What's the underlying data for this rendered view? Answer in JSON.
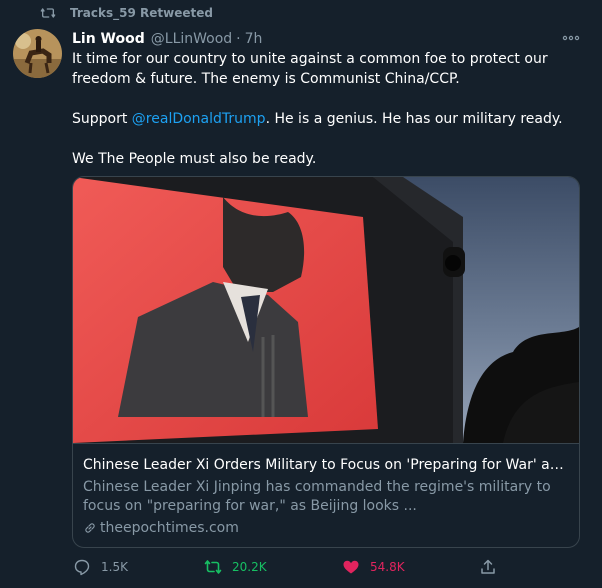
{
  "retweet_context": {
    "text": "Tracks_59 Retweeted"
  },
  "author": {
    "name": "Lin Wood",
    "handle": "@LLinWood",
    "separator": "·",
    "time": "7h"
  },
  "tweet": {
    "line1": "It time for our country to unite against a common foe to protect our freedom & future. The enemy is Communist China/CCP.",
    "line2_pre": "Support ",
    "line2_mention": "@realDonaldTrump",
    "line2_post": ". He is a genius. He has our military ready.",
    "line3": "We The People must also be ready."
  },
  "card": {
    "title": "Chinese Leader Xi Orders Military to Focus on 'Preparing for War' as Part...",
    "description": "Chinese Leader Xi Jinping has commanded the regime's military to focus on \"preparing for war,\" as Beijing looks ...",
    "domain": "theepochtimes.com"
  },
  "actions": {
    "reply_count": "1.5K",
    "retweet_count": "20.2K",
    "like_count": "54.8K"
  },
  "colors": {
    "background": "#15202b",
    "accent": "#1da1f2",
    "retweet": "#17bf63",
    "like": "#e0245e",
    "muted": "#8899a6"
  },
  "icons": [
    "retweet-icon",
    "more-icon",
    "link-icon",
    "reply-icon",
    "like-icon",
    "share-icon"
  ]
}
